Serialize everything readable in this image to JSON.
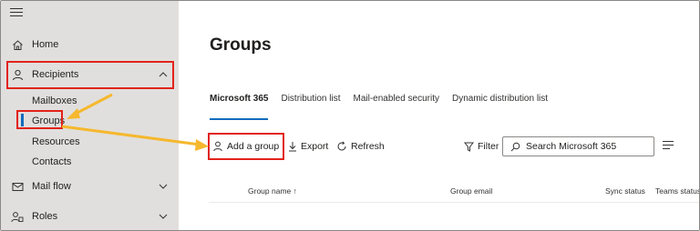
{
  "sidebar": {
    "items": [
      {
        "label": "Home",
        "icon": "home-icon"
      },
      {
        "label": "Recipients",
        "icon": "person-icon"
      },
      {
        "label": "Mail flow",
        "icon": "mail-icon"
      },
      {
        "label": "Roles",
        "icon": "roles-icon"
      }
    ],
    "sub_items": [
      "Mailboxes",
      "Groups",
      "Resources",
      "Contacts"
    ]
  },
  "main": {
    "title": "Groups",
    "tabs": [
      "Microsoft 365",
      "Distribution list",
      "Mail-enabled security",
      "Dynamic distribution list"
    ],
    "toolbar": {
      "add": "Add a group",
      "export": "Export",
      "refresh": "Refresh",
      "filter": "Filter",
      "search_placeholder": "Search Microsoft 365"
    },
    "table": {
      "columns": [
        "Group name ↑",
        "Group email",
        "Sync status",
        "Teams status"
      ]
    }
  },
  "colors": {
    "highlight": "#e2231a",
    "arrow": "#f5b82e",
    "accent": "#0f6cbd",
    "sidebar_bg": "#e1dfdd"
  }
}
